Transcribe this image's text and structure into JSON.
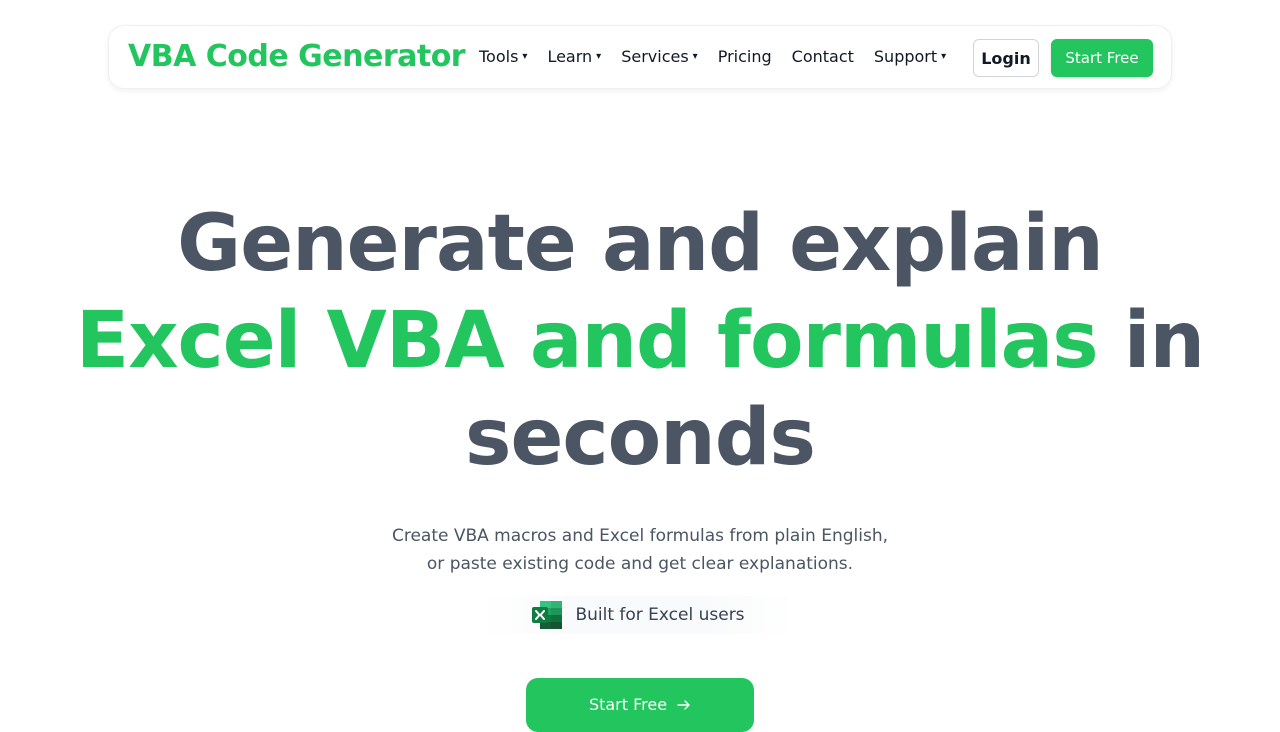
{
  "brand": {
    "name": "VBA Code Generator",
    "color": "#22c55e"
  },
  "nav": {
    "items": [
      {
        "label": "Tools",
        "has_dropdown": true
      },
      {
        "label": "Learn",
        "has_dropdown": true
      },
      {
        "label": "Services",
        "has_dropdown": true
      },
      {
        "label": "Pricing",
        "has_dropdown": false
      },
      {
        "label": "Contact",
        "has_dropdown": false
      },
      {
        "label": "Support",
        "has_dropdown": true
      }
    ],
    "caret": "▾",
    "login_label": "Login",
    "start_label": "Start Free"
  },
  "hero": {
    "title_line1": "Generate and explain",
    "title_accent": "Excel VBA and formulas",
    "title_after_accent": " in",
    "title_line3": "seconds",
    "subtitle_line1": "Create VBA macros and Excel formulas from plain English,",
    "subtitle_line2": "or paste existing code and get clear explanations.",
    "badge_text": "Built for Excel users",
    "badge_icon": "excel-icon",
    "cta_label": "Start Free",
    "cta_icon": "arrow-right-icon"
  },
  "colors": {
    "accent": "#22c55e",
    "heading": "#4b5563",
    "text": "#4b5563"
  }
}
